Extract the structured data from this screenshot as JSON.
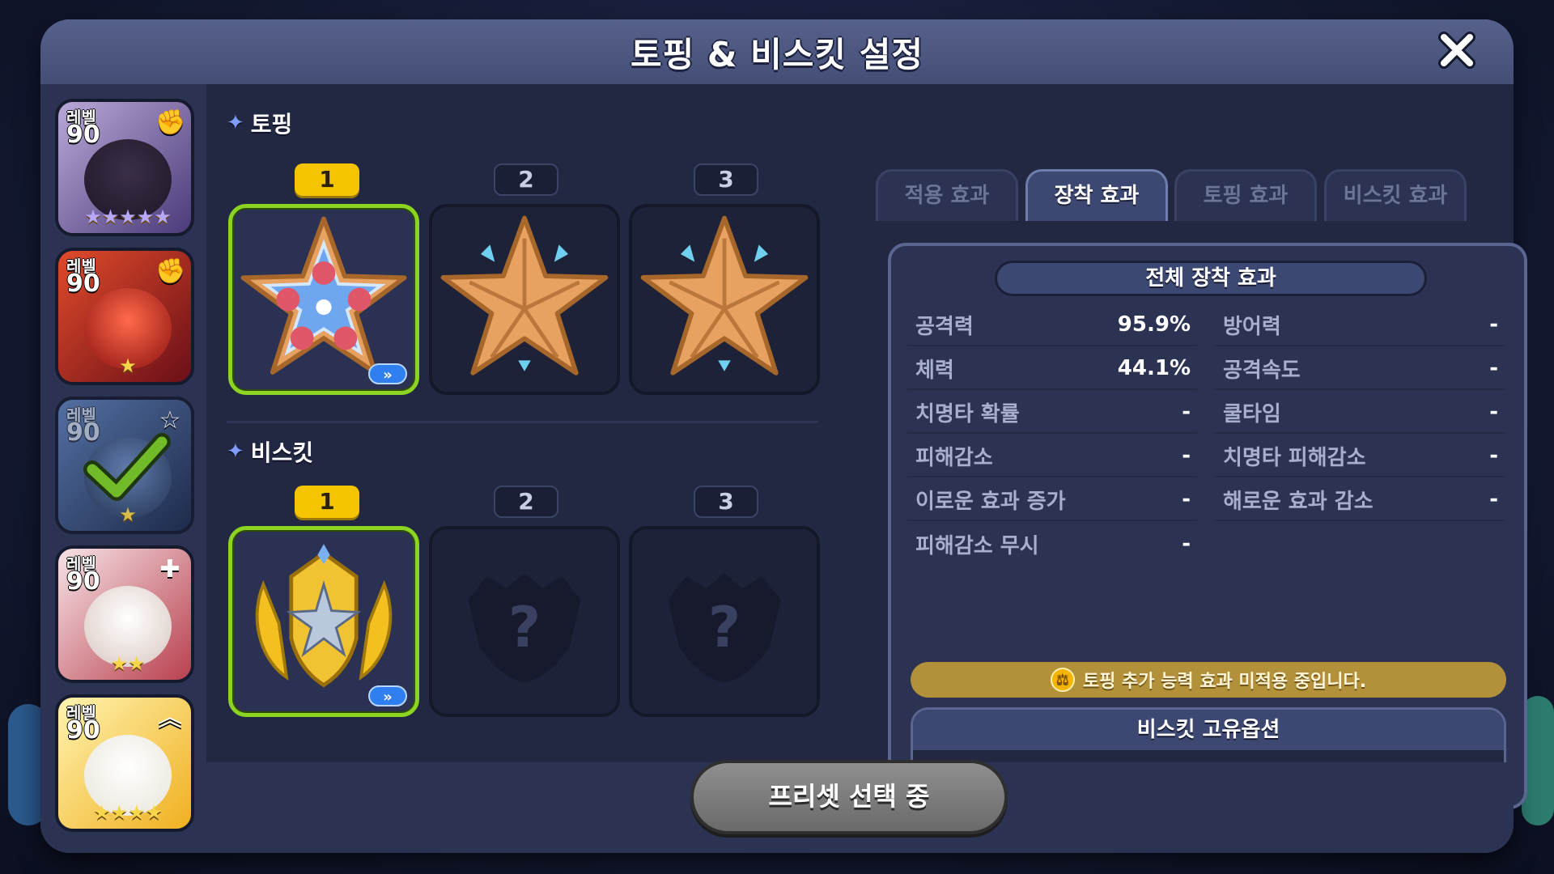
{
  "window": {
    "title": "토핑 & 비스킷 설정"
  },
  "sidebar": {
    "cookies": [
      {
        "level_label": "레벨",
        "level": "90",
        "role_icon": "fist-icon",
        "stars": "★★★★★",
        "color": "#7a6aa8"
      },
      {
        "level_label": "레벨",
        "level": "90",
        "role_icon": "fist-icon",
        "stars": "★",
        "color": "#c22a2a"
      },
      {
        "level_label": "레벨",
        "level": "90",
        "role_icon": "star-icon",
        "stars": "★",
        "color": "#3b5a8a",
        "selected": true
      },
      {
        "level_label": "레벨",
        "level": "90",
        "role_icon": "plus-icon",
        "stars": "★★",
        "color": "#e8c2c8"
      },
      {
        "level_label": "레벨",
        "level": "90",
        "role_icon": "chevron-up-icon",
        "stars": "★★★★",
        "color": "#f2d64b"
      }
    ]
  },
  "toppings": {
    "label": "토핑",
    "slots": [
      {
        "number": "1",
        "state": "equipped"
      },
      {
        "number": "2",
        "state": "equipped"
      },
      {
        "number": "3",
        "state": "equipped"
      }
    ]
  },
  "biscuits": {
    "label": "비스킷",
    "slots": [
      {
        "number": "1",
        "state": "equipped"
      },
      {
        "number": "2",
        "state": "empty",
        "placeholder": "?"
      },
      {
        "number": "3",
        "state": "empty",
        "placeholder": "?"
      }
    ]
  },
  "upgrade_chip": "»",
  "tabs": [
    {
      "label": "적용 효과",
      "active": false
    },
    {
      "label": "장착 효과",
      "active": true
    },
    {
      "label": "토핑 효과",
      "active": false
    },
    {
      "label": "비스킷 효과",
      "active": false
    }
  ],
  "effects": {
    "header": "전체 장착 효과",
    "left": [
      {
        "name": "공격력",
        "value": "95.9%"
      },
      {
        "name": "체력",
        "value": "44.1%"
      },
      {
        "name": "치명타 확률",
        "value": "-"
      },
      {
        "name": "피해감소",
        "value": "-"
      },
      {
        "name": "이로운 효과 증가",
        "value": "-"
      },
      {
        "name": "피해감소 무시",
        "value": "-"
      }
    ],
    "right": [
      {
        "name": "방어력",
        "value": "-"
      },
      {
        "name": "공격속도",
        "value": "-"
      },
      {
        "name": "쿨타임",
        "value": "-"
      },
      {
        "name": "치명타 피해감소",
        "value": "-"
      },
      {
        "name": "해로운 효과 감소",
        "value": "-"
      }
    ],
    "notice": "토핑 추가 능력 효과 미적용 중입니다.",
    "unique_title": "비스킷 고유옵션",
    "unique_value": "-"
  },
  "preset_button": "프리셋 선택 중"
}
